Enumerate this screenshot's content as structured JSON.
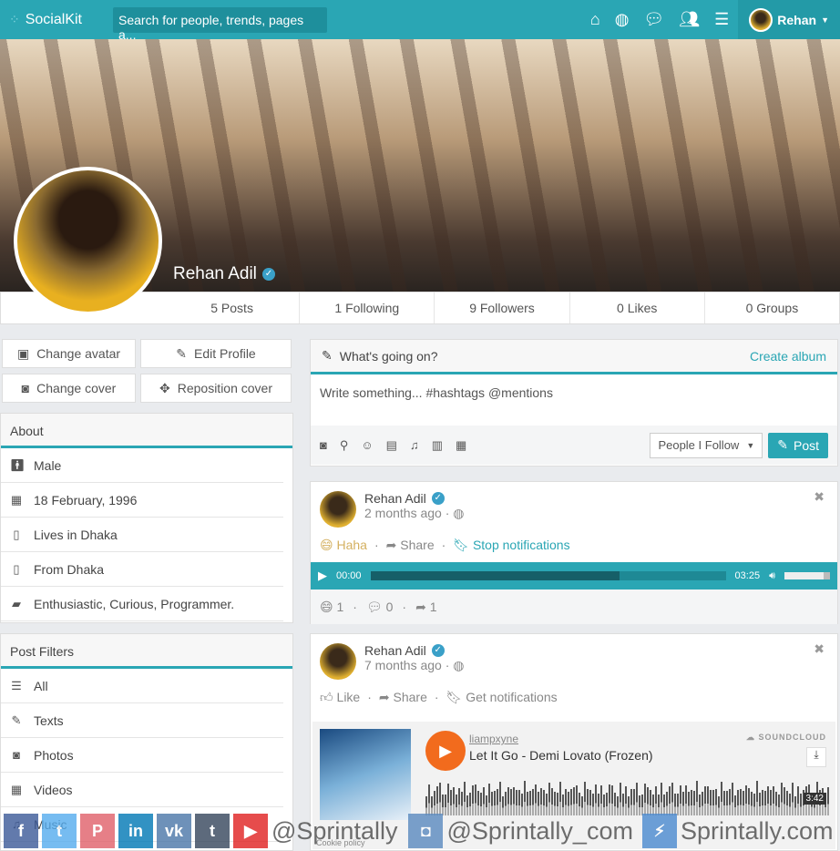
{
  "nav": {
    "logo": "SocialKit",
    "search_placeholder": "Search for people, trends, pages a...",
    "icons": [
      "home-icon",
      "globe-icon",
      "comments-icon",
      "users-icon",
      "menu-icon"
    ],
    "user": "Rehan",
    "accent": "#2aa6b4"
  },
  "profile": {
    "name": "Rehan Adil",
    "stats": [
      "5 Posts",
      "1 Following",
      "9 Followers",
      "0 Likes",
      "0 Groups"
    ]
  },
  "actions": {
    "change_avatar": "Change avatar",
    "edit_profile": "Edit Profile",
    "change_cover": "Change cover",
    "reposition_cover": "Reposition cover"
  },
  "about": {
    "title": "About",
    "items": [
      {
        "icon": "male-icon",
        "text": "Male"
      },
      {
        "icon": "calendar-icon",
        "text": "18 February, 1996"
      },
      {
        "icon": "building-icon",
        "text": "Lives in Dhaka"
      },
      {
        "icon": "building-icon",
        "text": "From Dhaka"
      },
      {
        "icon": "book-icon",
        "text": "Enthusiastic, Curious, Programmer."
      }
    ]
  },
  "filters": {
    "title": "Post Filters",
    "items": [
      {
        "icon": "list-icon",
        "text": "All"
      },
      {
        "icon": "pencil-icon",
        "text": "Texts"
      },
      {
        "icon": "camera-icon",
        "text": "Photos"
      },
      {
        "icon": "film-icon",
        "text": "Videos"
      },
      {
        "icon": "music-icon",
        "text": "Music"
      }
    ]
  },
  "composer": {
    "title": "What's going on?",
    "create_album": "Create album",
    "placeholder": "Write something... #hashtags @mentions",
    "audience": "People I Follow",
    "post": "Post"
  },
  "post1": {
    "author": "Rehan Adil",
    "time": "2 months ago",
    "reaction": "Haha",
    "share": "Share",
    "notif": "Stop notifications",
    "audio_start": "00:00",
    "audio_end": "03:25",
    "audio_progress": 0.7,
    "volume": 0.85,
    "counts": [
      "1",
      "0",
      "1"
    ]
  },
  "post2": {
    "author": "Rehan Adil",
    "time": "7 months ago",
    "like": "Like",
    "share": "Share",
    "notif": "Get notifications",
    "sc_user": "liampxyne",
    "sc_title": "Let It Go - Demi Lovato (Frozen)",
    "sc_brand": "SOUNDCLOUD",
    "sc_duration": "3:42"
  },
  "footer": {
    "cookie": "Cookie policy"
  },
  "watermark": {
    "handle1": "@Sprintally",
    "handle2": "@Sprintally_com",
    "site": "Sprintally.com"
  }
}
